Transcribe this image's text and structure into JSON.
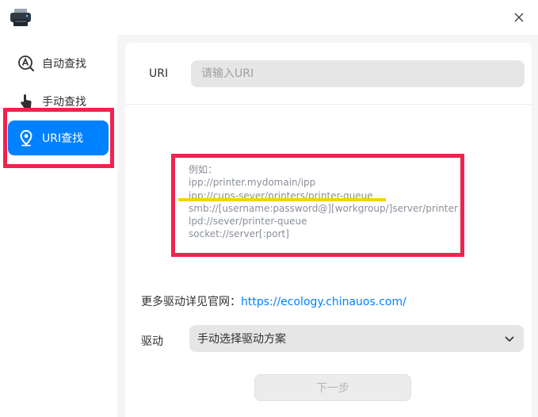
{
  "window": {
    "close_icon": "close-icon",
    "app_icon": "printer-icon"
  },
  "sidebar": {
    "items": [
      {
        "label": "自动查找",
        "icon": "auto-find-icon",
        "active": false
      },
      {
        "label": "手动查找",
        "icon": "manual-find-icon",
        "active": false
      },
      {
        "label": "URI查找",
        "icon": "location-pin-icon",
        "active": true
      }
    ]
  },
  "uri": {
    "label": "URI",
    "placeholder": "请输入URI",
    "value": ""
  },
  "examples": {
    "heading": "例如：",
    "lines": [
      "ipp://printer.mydomain/ipp",
      "ipp://cups-sever/printers/printer-queue",
      "smb://[username:password@][workgroup/]server/printer",
      "lpd://sever/printer-queue",
      "socket://server[:port]"
    ]
  },
  "more_drivers": {
    "prefix": "更多驱动详见官网：",
    "link": "https://ecology.chinauos.com/"
  },
  "driver": {
    "label": "驱动",
    "selected": "手动选择驱动方案"
  },
  "next_button": {
    "label": "下一步",
    "enabled": false
  },
  "colors": {
    "accent": "#0081ff",
    "annotation_red": "#f0224f",
    "annotation_yellow": "#f5d400"
  }
}
